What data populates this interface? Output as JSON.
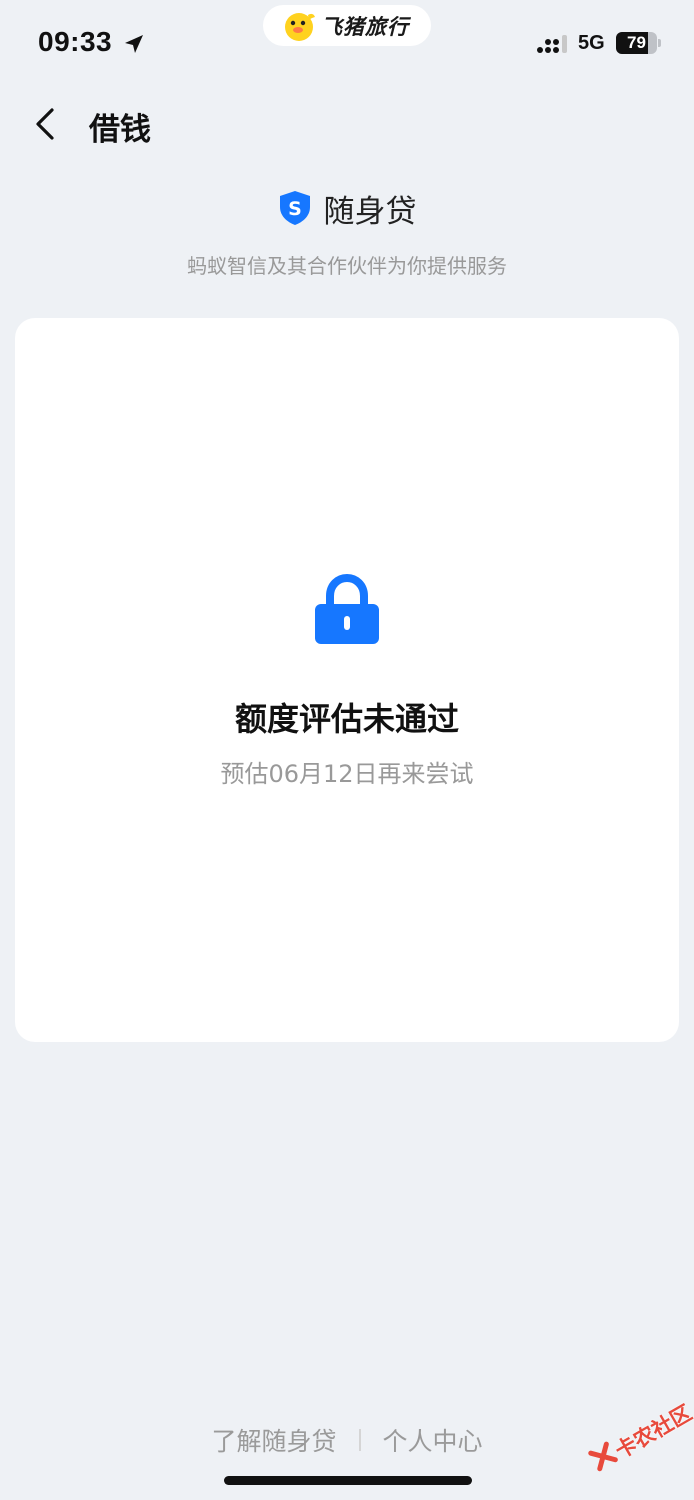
{
  "status_bar": {
    "time": "09:33",
    "app_name": "飞猪旅行",
    "network": "5G",
    "battery": "79",
    "battery_fraction": 0.79
  },
  "nav": {
    "title": "借钱"
  },
  "brand": {
    "name": "随身贷",
    "subtitle": "蚂蚁智信及其合作伙伴为你提供服务",
    "accent": "#1677ff"
  },
  "card": {
    "title": "额度评估未通过",
    "hint": "预估06月12日再来尝试"
  },
  "footer": {
    "learn_more": "了解随身贷",
    "personal_center": "个人中心"
  },
  "watermark": {
    "text": "卡农社区"
  },
  "icons": [
    "location-arrow-icon",
    "fliggy-logo-icon",
    "signal-icon",
    "battery-icon",
    "back-chevron-icon",
    "shield-s-icon",
    "lock-icon"
  ]
}
